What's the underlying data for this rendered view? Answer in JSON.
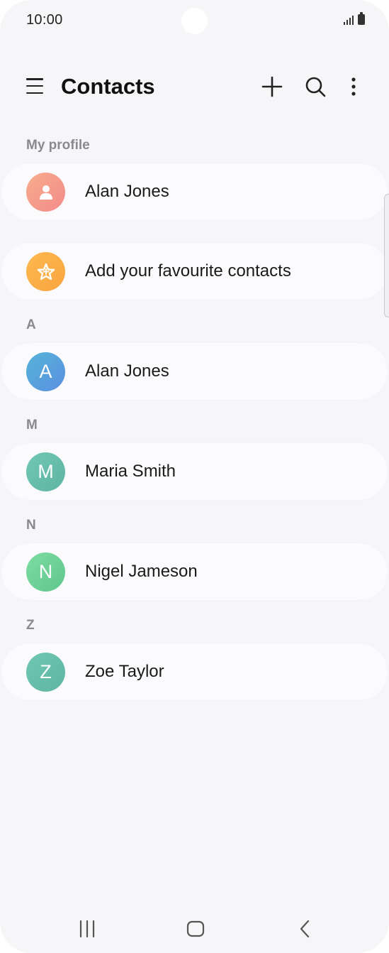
{
  "status_bar": {
    "time": "10:00",
    "icons": [
      "signal-icon",
      "battery-icon"
    ]
  },
  "app_bar": {
    "title": "Contacts",
    "icons": [
      "menu-icon",
      "add-icon",
      "search-icon",
      "more-options-icon"
    ]
  },
  "sections": {
    "my_profile": {
      "label": "My profile",
      "name": "Alan Jones",
      "avatar_icon": "person-icon",
      "avatar_color": "#f39a8c"
    },
    "favourites": {
      "label": "Add your favourite contacts",
      "avatar_icon": "star-icon",
      "avatar_color": "#fbad49"
    }
  },
  "contact_groups": [
    {
      "letter": "A",
      "contacts": [
        {
          "name": "Alan Jones",
          "initial": "A",
          "avatar_color": "#5aa6dd"
        }
      ]
    },
    {
      "letter": "M",
      "contacts": [
        {
          "name": "Maria Smith",
          "initial": "M",
          "avatar_color": "#6cc3b0"
        }
      ]
    },
    {
      "letter": "N",
      "contacts": [
        {
          "name": "Nigel Jameson",
          "initial": "N",
          "avatar_color": "#72d49a"
        }
      ]
    },
    {
      "letter": "Z",
      "contacts": [
        {
          "name": "Zoe Taylor",
          "initial": "Z",
          "avatar_color": "#6cc3b0"
        }
      ]
    }
  ],
  "nav_bar": {
    "icons": [
      "recent-apps-icon",
      "home-icon",
      "back-icon"
    ]
  }
}
